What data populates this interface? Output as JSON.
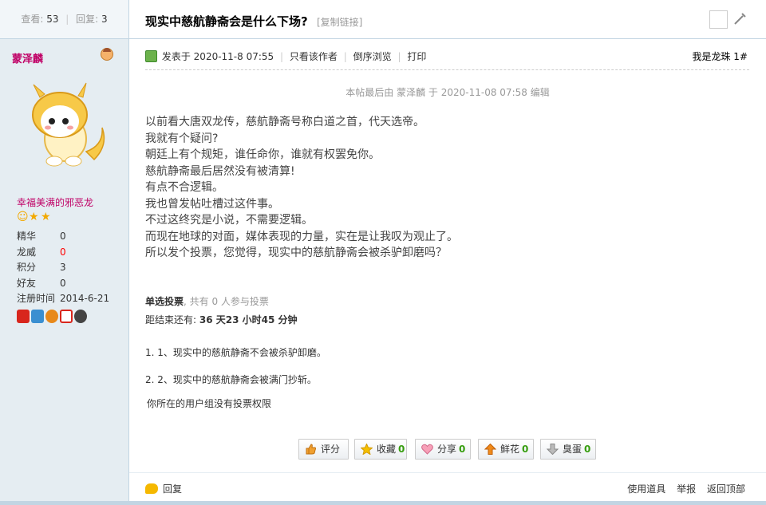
{
  "sidebar": {
    "views_label": "查看:",
    "views": "53",
    "replies_label": "回复:",
    "replies": "3",
    "author": "蒙泽麟",
    "group": "幸福美满的邪恶龙",
    "stats": [
      {
        "k": "精华",
        "v": "0"
      },
      {
        "k": "龙威",
        "v": "0"
      },
      {
        "k": "积分",
        "v": "3"
      },
      {
        "k": "好友",
        "v": "0"
      },
      {
        "k": "注册时间",
        "v": "2014-6-21"
      }
    ]
  },
  "thread": {
    "title": "现实中慈航静斋会是什么下场?",
    "copy_link": "[复制链接]"
  },
  "post": {
    "posted_prefix": "发表于",
    "posted_time": "2020-11-8 07:55",
    "only_author": "只看该作者",
    "reverse": "倒序浏览",
    "print": "打印",
    "floor_label": "我是龙珠",
    "floor_num": "1#",
    "edited": "本帖最后由 蒙泽麟 于 2020-11-08 07:58 编辑",
    "lines": [
      "以前看大唐双龙传，慈航静斋号称白道之首，代天选帝。",
      "我就有个疑问?",
      "朝廷上有个规矩，谁任命你，谁就有权罢免你。",
      "慈航静斋最后居然没有被清算!",
      "有点不合逻辑。",
      "我也曾发帖吐槽过这件事。",
      "不过这终究是小说，不需要逻辑。",
      "而现在地球的对面，媒体表现的力量，实在是让我叹为观止了。",
      "所以发个投票，您觉得，现实中的慈航静斋会被杀驴卸磨吗？"
    ]
  },
  "poll": {
    "type": "单选投票",
    "count_text": ", 共有 0 人参与投票",
    "end_label": "距结束还有:",
    "end_value": "36 天23 小时45 分钟",
    "options": [
      "1.  1、现实中的慈航静斋不会被杀驴卸磨。",
      "2.  2、现实中的慈航静斋会被满门抄斩。"
    ],
    "no_permission": "你所在的用户组没有投票权限"
  },
  "actions": {
    "rate": "评分",
    "fav": "收藏",
    "fav_n": "0",
    "share": "分享",
    "share_n": "0",
    "flower": "鲜花",
    "flower_n": "0",
    "egg": "臭蛋",
    "egg_n": "0"
  },
  "footer": {
    "reply": "回复",
    "use_tool": "使用道具",
    "report": "举报",
    "top": "返回顶部"
  },
  "colors": {
    "accent": "#c00066",
    "count": "#369d0e",
    "sidebar_bg": "#e5edf2",
    "border": "#c2d5e3"
  }
}
